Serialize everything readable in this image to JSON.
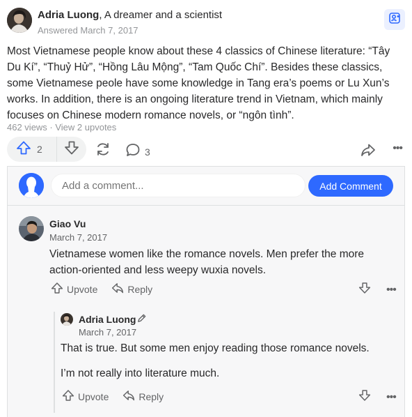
{
  "answer": {
    "author_name": "Adria Luong",
    "author_credential": ", A dreamer and a scientist",
    "answered_date": "Answered March 7, 2017",
    "body": "Most Vietnamese people know about these 4 classics of Chinese literature: “Tây Du Kí”, “Thuỷ Hử”, “Hồng Lâu Mộng”, “Tam Quốc Chí”. Besides these classics, some Vietnamese peole have some knowledge in Tang era’s poems or Lu Xun’s works. In addition, there is an ongoing literature trend in Vietnam, which mainly focuses on Chinese modern romance novels, or “ngôn tình”.",
    "stats": "462 views · View 2 upvotes",
    "upvote_count": "2",
    "comment_count": "3",
    "more_label": "•••"
  },
  "comments": {
    "input_placeholder": "Add a comment...",
    "add_button_label": "Add Comment",
    "items": [
      {
        "author": "Giao Vu",
        "date": "March 7, 2017",
        "text": "Vietnamese women like the romance novels. Men prefer the more action-oriented and less weepy wuxia novels.",
        "upvote_label": "Upvote",
        "reply_label": "Reply"
      },
      {
        "author": "Adria Luong",
        "date": "March 7, 2017",
        "text1": "That is true. But some men enjoy reading those romance novels.",
        "text2": "I’m not really into literature much.",
        "upvote_label": "Upvote",
        "reply_label": "Reply"
      }
    ]
  },
  "colors": {
    "accent": "#2e69ff",
    "muted": "#939598",
    "panel": "#f7f7f8"
  },
  "icons": [
    "request-icon",
    "upvote-icon",
    "downvote-icon",
    "share-icon",
    "comment-icon",
    "forward-icon",
    "more-icon",
    "pencil-icon"
  ]
}
